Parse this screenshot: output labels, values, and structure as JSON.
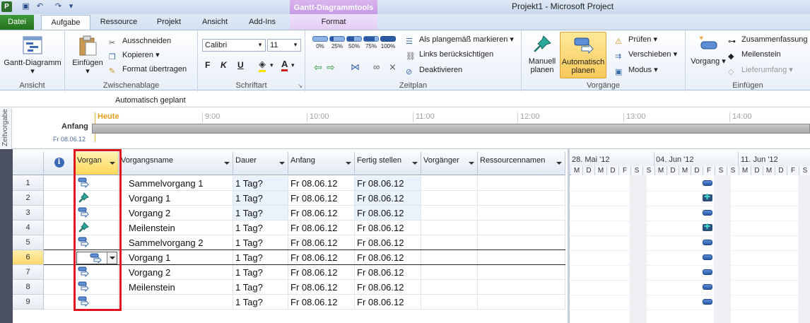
{
  "titlebar": {
    "title": "Projekt1 - Microsoft Project",
    "contextual": "Gantt-Diagrammtools"
  },
  "tabs": [
    {
      "label": "Datei"
    },
    {
      "label": "Aufgabe"
    },
    {
      "label": "Ressource"
    },
    {
      "label": "Projekt"
    },
    {
      "label": "Ansicht"
    },
    {
      "label": "Add-Ins"
    },
    {
      "label": "Format"
    }
  ],
  "ribbon": {
    "view_group": {
      "button": "Gantt-Diagramm",
      "label": "Ansicht"
    },
    "clipboard": {
      "paste": "Einfügen",
      "cut": "Ausschneiden",
      "copy": "Kopieren",
      "format_painter": "Format übertragen",
      "label": "Zwischenablage"
    },
    "font": {
      "name": "Calibri",
      "size": "11",
      "bold": "F",
      "italic": "K",
      "underline": "U",
      "label": "Schriftart"
    },
    "schedule": {
      "pcts": [
        "0%",
        "25%",
        "50%",
        "75%",
        "100%"
      ],
      "mark_on_track": "Als plangemäß markieren",
      "respect_links": "Links berücksichtigen",
      "inactivate": "Deaktivieren",
      "label": "Zeitplan"
    },
    "tasks": {
      "manual": "Manuell planen",
      "auto": "Automatisch planen",
      "inspect": "Prüfen",
      "move": "Verschieben",
      "mode": "Modus",
      "label": "Vorgänge"
    },
    "insert": {
      "task": "Vorgang",
      "summary": "Zusammenfassung",
      "milestone": "Meilenstein",
      "deliverable": "Lieferumfang",
      "label": "Einfügen"
    }
  },
  "entrybar": {
    "text": "Automatisch geplant"
  },
  "timeline": {
    "side": "Zeitvorgabe",
    "today": "Heute",
    "start": "Anfang",
    "start_date": "Fr 08.06.12",
    "hours": [
      "9:00",
      "10:00",
      "11:00",
      "12:00",
      "13:00",
      "14:00"
    ]
  },
  "table": {
    "headers": {
      "mode": "Vorgan",
      "name": "Vorgangsname",
      "duration": "Dauer",
      "start": "Anfang",
      "finish": "Fertig stellen",
      "predecessors": "Vorgänger",
      "resources": "Ressourcennamen"
    },
    "rows": [
      {
        "num": "1",
        "mode": "auto",
        "name": "Sammelvorgang 1",
        "duration": "1 Tag?",
        "start": "Fr 08.06.12",
        "finish": "Fr 08.06.12"
      },
      {
        "num": "2",
        "mode": "manual",
        "name": "Vorgang 1",
        "duration": "1 Tag?",
        "start": "Fr 08.06.12",
        "finish": "Fr 08.06.12"
      },
      {
        "num": "3",
        "mode": "auto",
        "name": "Vorgang 2",
        "duration": "1 Tag?",
        "start": "Fr 08.06.12",
        "finish": "Fr 08.06.12"
      },
      {
        "num": "4",
        "mode": "manual",
        "name": "Meilenstein",
        "duration": "1 Tag?",
        "start": "Fr 08.06.12",
        "finish": "Fr 08.06.12"
      },
      {
        "num": "5",
        "mode": "auto",
        "name": "Sammelvorgang 2",
        "duration": "1 Tag?",
        "start": "Fr 08.06.12",
        "finish": "Fr 08.06.12"
      },
      {
        "num": "6",
        "mode": "auto",
        "name": "Vorgang 1",
        "duration": "1 Tag?",
        "start": "Fr 08.06.12",
        "finish": "Fr 08.06.12"
      },
      {
        "num": "7",
        "mode": "auto",
        "name": "Vorgang 2",
        "duration": "1 Tag?",
        "start": "Fr 08.06.12",
        "finish": "Fr 08.06.12"
      },
      {
        "num": "8",
        "mode": "auto",
        "name": "Meilenstein",
        "duration": "1 Tag?",
        "start": "Fr 08.06.12",
        "finish": "Fr 08.06.12"
      },
      {
        "num": "9",
        "mode": "auto",
        "name": "",
        "duration": "1 Tag?",
        "start": "Fr 08.06.12",
        "finish": "Fr 08.06.12"
      }
    ]
  },
  "gantt": {
    "weeks": [
      "28. Mai '12",
      "04. Jun '12",
      "11. Jun '12"
    ],
    "days": [
      "M",
      "D",
      "M",
      "D",
      "F",
      "S",
      "S",
      "M",
      "D",
      "M",
      "D",
      "F",
      "S",
      "S",
      "M",
      "D",
      "M",
      "D",
      "F",
      "S",
      "S"
    ]
  },
  "colors": {
    "accent_red": "#e0141e",
    "bar_blue": "#2a5aa6",
    "header_yellow": "#ffd65a"
  }
}
